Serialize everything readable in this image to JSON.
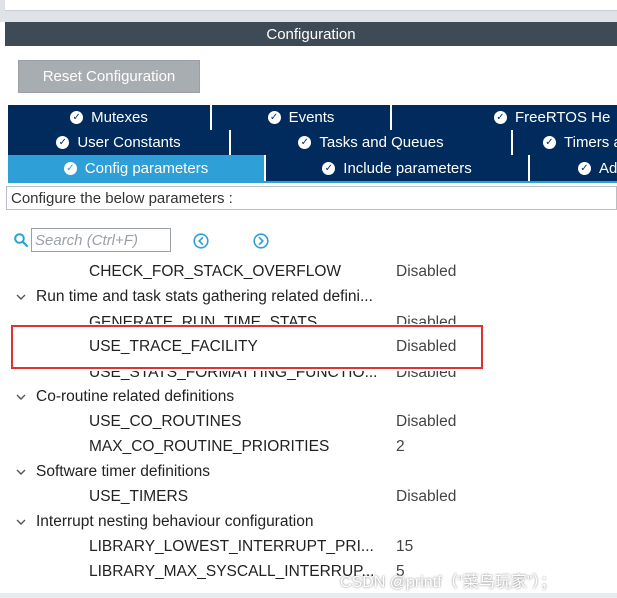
{
  "panel": {
    "title": "Configuration"
  },
  "toolbar": {
    "reset_label": "Reset Configuration"
  },
  "tabs": {
    "row1": [
      "Mutexes",
      "Events",
      "FreeRTOS He"
    ],
    "row2": [
      "User Constants",
      "Tasks and Queues",
      "Timers a"
    ],
    "row3": [
      "Config parameters",
      "Include parameters",
      "Ad"
    ],
    "active": "Config parameters"
  },
  "configure_label": "Configure the below parameters :",
  "search": {
    "placeholder": "Search (Ctrl+F)"
  },
  "tree": [
    {
      "kind": "param",
      "label": "CHECK_FOR_STACK_OVERFLOW",
      "value": "Disabled"
    },
    {
      "kind": "group",
      "label": "Run time and task stats gathering related defini..."
    },
    {
      "kind": "param",
      "label": "GENERATE_RUN_TIME_STATS",
      "value": "Disabled"
    },
    {
      "kind": "param",
      "label": "USE_TRACE_FACILITY",
      "value": "Disabled"
    },
    {
      "kind": "param",
      "label": "USE_STATS_FORMATTING_FUNCTIO...",
      "value": "Disabled"
    },
    {
      "kind": "group",
      "label": "Co-routine related definitions"
    },
    {
      "kind": "param",
      "label": "USE_CO_ROUTINES",
      "value": "Disabled"
    },
    {
      "kind": "param",
      "label": "MAX_CO_ROUTINE_PRIORITIES",
      "value": "2"
    },
    {
      "kind": "group",
      "label": "Software timer definitions"
    },
    {
      "kind": "param",
      "label": "USE_TIMERS",
      "value": "Disabled"
    },
    {
      "kind": "group",
      "label": "Interrupt nesting behaviour configuration"
    },
    {
      "kind": "param",
      "label": "LIBRARY_LOWEST_INTERRUPT_PRI...",
      "value": "15"
    },
    {
      "kind": "param",
      "label": "LIBRARY_MAX_SYSCALL_INTERRUP...",
      "value": "5"
    }
  ],
  "highlighted": "USE_TRACE_FACILITY",
  "watermark": "CSDN @printf（“菜鸟玩家”）；",
  "colors": {
    "title_bar": "#3e4a55",
    "tab_bg": "#002b5c",
    "tab_active": "#2f9fd8",
    "button_bg": "#a8adb2",
    "highlight": "#e0322f"
  },
  "icons": {
    "tab": "check-circle-icon",
    "search": "search-icon",
    "prev": "previous-circle-icon",
    "next": "next-circle-icon",
    "group": "chevron-down-icon"
  }
}
